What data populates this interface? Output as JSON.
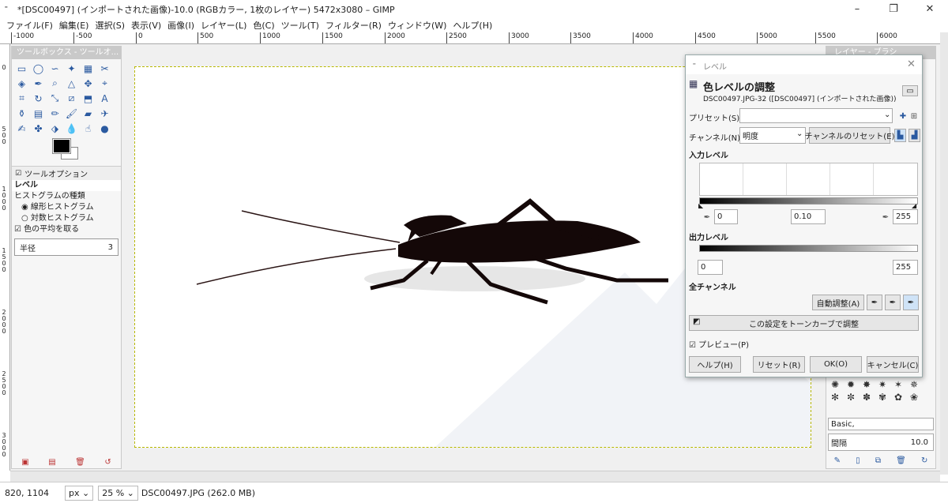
{
  "window": {
    "title": "*[DSC00497] (インポートされた画像)-10.0 (RGBカラー, 1枚のレイヤー) 5472x3080 – GIMP",
    "app_icon": "gimp-icon",
    "minimize": "–",
    "maximize": "❐",
    "close": "✕"
  },
  "menu": [
    "ファイル(F)",
    "編集(E)",
    "選択(S)",
    "表示(V)",
    "画像(I)",
    "レイヤー(L)",
    "色(C)",
    "ツール(T)",
    "フィルター(R)",
    "ウィンドウ(W)",
    "ヘルプ(H)"
  ],
  "ruler": {
    "h": [
      "-1000",
      "-500",
      "0",
      "500",
      "1000",
      "1500",
      "2000",
      "2500",
      "3000",
      "3500",
      "4000",
      "4500",
      "5000",
      "5500",
      "6000"
    ],
    "v": [
      "0",
      "5 0 0",
      "1 0 0 0",
      "1 5 0 0",
      "2 0 0 0",
      "2 5 0 0",
      "3 0 0 0"
    ]
  },
  "toolbox": {
    "title": "ツールボックス - ツールオ...",
    "options_title": "ツールオプション",
    "tool_name": "レベル",
    "histogram_label": "ヒストグラムの種類",
    "linear": "線形ヒストグラム",
    "log": "対数ヒストグラム",
    "average": "色の平均を取る",
    "radius_label": "半径",
    "radius_value": "3"
  },
  "dock": {
    "title": "レイヤー - ブラシ",
    "brush_name": "Basic,",
    "spacing_label": "間隔",
    "spacing_value": "10.0"
  },
  "dialog": {
    "titlebar": "レベル",
    "heading": "色レベルの調整",
    "subheading": "DSC00497.JPG-32 ([DSC00497] (インポートされた画像))",
    "preset_label": "プリセット(S):",
    "preset_value": "",
    "channel_label": "チャンネル(N):",
    "channel_value": "明度",
    "reset_channel": "チャンネルのリセット(E)",
    "input_levels": "入力レベル",
    "input_low": "0",
    "input_gamma": "0.10",
    "input_high": "255",
    "output_levels": "出力レベル",
    "output_low": "0",
    "output_high": "255",
    "all_channels": "全チャンネル",
    "auto": "自動調整(A)",
    "to_curves": "この設定をトーンカーブで調整",
    "preview": "プレビュー(P)",
    "help": "ヘルプ(H)",
    "reset": "リセット(R)",
    "ok": "OK(O)",
    "cancel": "キャンセル(C)"
  },
  "status": {
    "coords": "820, 1104",
    "unit": "px",
    "zoom": "25 %",
    "file": "DSC00497.JPG (262.0 MB)"
  },
  "colors": {
    "insect": "#140808",
    "guide": "#b8b800",
    "panel": "#f6f6f6"
  }
}
